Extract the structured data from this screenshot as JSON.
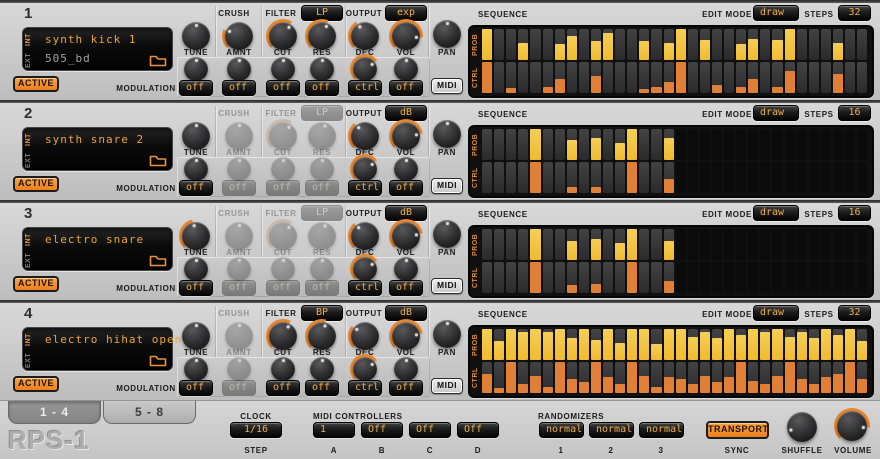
{
  "shared_labels": {
    "crush": "CRUSH",
    "filter": "FILTER",
    "output": "OUTPUT",
    "tune": "TUNE",
    "amnt": "AMNT",
    "cut": "CUT",
    "res": "RES",
    "dec": "DEC",
    "vol": "VOL",
    "pan": "PAN",
    "midi": "MIDI",
    "modulation": "MODULATION",
    "active": "ACTIVE",
    "sequence": "SEQUENCE",
    "edit_mode": "EDIT MODE",
    "steps": "STEPS",
    "prob": "PROB",
    "ctrl": "CTRL",
    "int": "INT",
    "ext": "EXT"
  },
  "colors": {
    "accent_orange": "#ee8626",
    "prob_bar": "#f2c33c",
    "ctrl_bar": "#e08036",
    "dropdown_text": "#edae4e"
  },
  "channels": [
    {
      "number": "1",
      "int_name": "synth kick 1",
      "ext_name": "505_bd",
      "filter_mode": "LP",
      "output_mode": "exp",
      "crush_disabled": false,
      "filter_disabled": false,
      "knobs": [
        {
          "v": 0.5,
          "arc": 0
        },
        {
          "v": 0.25,
          "arc": 1
        },
        {
          "v": 0.62,
          "arc": 1
        },
        {
          "v": 0.58,
          "arc": 1
        },
        {
          "v": 0.38,
          "arc": 1
        },
        {
          "v": 0.85,
          "arc": 1
        }
      ],
      "pan": {
        "v": 0.5,
        "arc": 0
      },
      "mod_knobs": [
        {
          "v": 0.5,
          "arc": 0
        },
        {
          "v": 0.5,
          "arc": 0
        },
        {
          "v": 0.5,
          "arc": 0
        },
        {
          "v": 0.5,
          "arc": 0
        },
        {
          "v": 0.7,
          "arc": 1
        },
        {
          "v": 0.5,
          "arc": 0
        }
      ],
      "mod_values": [
        "off",
        "off",
        "off",
        "off",
        "ctrl",
        "off"
      ],
      "sequence": {
        "edit_mode": "draw",
        "steps": 32,
        "prob": [
          1,
          0,
          0,
          0.55,
          0,
          0,
          0.5,
          0.78,
          0,
          0.62,
          0.88,
          0,
          0,
          0.6,
          0,
          0.55,
          1,
          0,
          0.65,
          0,
          0,
          0.5,
          0.68,
          0,
          0.65,
          1,
          0,
          0,
          0,
          0.55,
          0,
          0
        ],
        "ctrl": [
          1,
          0,
          0.15,
          0,
          0,
          0.2,
          0.45,
          0,
          0,
          0.55,
          0,
          0,
          0,
          0.12,
          0.18,
          0.35,
          1,
          0,
          0,
          0.25,
          0,
          0.2,
          0.45,
          0,
          0.2,
          0.7,
          0,
          0,
          0,
          0.6,
          0,
          0
        ]
      }
    },
    {
      "number": "2",
      "int_name": "synth snare 2",
      "ext_name": "",
      "filter_mode": "LP",
      "output_mode": "dB",
      "crush_disabled": true,
      "filter_disabled": true,
      "knobs": [
        {
          "v": 0.5,
          "arc": 0
        },
        {
          "v": 0.5,
          "arc": 0
        },
        {
          "v": 0.62,
          "arc": 1
        },
        {
          "v": 0.55,
          "arc": 0
        },
        {
          "v": 0.35,
          "arc": 1
        },
        {
          "v": 0.8,
          "arc": 1
        }
      ],
      "pan": {
        "v": 0.5,
        "arc": 0
      },
      "mod_knobs": [
        {
          "v": 0.5,
          "arc": 0
        },
        {
          "v": 0.5,
          "arc": 0
        },
        {
          "v": 0.5,
          "arc": 0
        },
        {
          "v": 0.5,
          "arc": 0
        },
        {
          "v": 0.7,
          "arc": 1
        },
        {
          "v": 0.5,
          "arc": 0
        }
      ],
      "mod_values": [
        "off",
        "off",
        "off",
        "off",
        "ctrl",
        "off"
      ],
      "sequence": {
        "edit_mode": "draw",
        "steps": 16,
        "prob": [
          0,
          0,
          0,
          0,
          1,
          0,
          0,
          0.65,
          0,
          0.7,
          0,
          0.55,
          1,
          0,
          0,
          0.72,
          0,
          0,
          0,
          0,
          0,
          0,
          0,
          0,
          0,
          0,
          0,
          0,
          0,
          0,
          0,
          0
        ],
        "ctrl": [
          0,
          0,
          0,
          0,
          1,
          0,
          0,
          0.2,
          0,
          0.2,
          0,
          0,
          1,
          0,
          0,
          0.45,
          0,
          0,
          0,
          0,
          0,
          0,
          0,
          0,
          0,
          0,
          0,
          0,
          0,
          0,
          0,
          0
        ]
      }
    },
    {
      "number": "3",
      "int_name": "electro snare",
      "ext_name": "",
      "filter_mode": "LP",
      "output_mode": "dB",
      "crush_disabled": true,
      "filter_disabled": true,
      "knobs": [
        {
          "v": 0.45,
          "arc": 1
        },
        {
          "v": 0.5,
          "arc": 0
        },
        {
          "v": 0.62,
          "arc": 1
        },
        {
          "v": 0.55,
          "arc": 0
        },
        {
          "v": 0.35,
          "arc": 1
        },
        {
          "v": 0.8,
          "arc": 1
        }
      ],
      "pan": {
        "v": 0.5,
        "arc": 0
      },
      "mod_knobs": [
        {
          "v": 0.5,
          "arc": 0
        },
        {
          "v": 0.5,
          "arc": 0
        },
        {
          "v": 0.5,
          "arc": 0
        },
        {
          "v": 0.5,
          "arc": 0
        },
        {
          "v": 0.7,
          "arc": 1
        },
        {
          "v": 0.5,
          "arc": 0
        }
      ],
      "mod_values": [
        "off",
        "off",
        "off",
        "off",
        "ctrl",
        "off"
      ],
      "sequence": {
        "edit_mode": "draw",
        "steps": 16,
        "prob": [
          0,
          0,
          0,
          0,
          1,
          0,
          0,
          0.6,
          0,
          0.68,
          0,
          0.55,
          1,
          0,
          0,
          0.6,
          0,
          0,
          0,
          0,
          0,
          0,
          0,
          0,
          0,
          0,
          0,
          0,
          0,
          0,
          0,
          0
        ],
        "ctrl": [
          0,
          0,
          0,
          0,
          1,
          0,
          0,
          0.25,
          0,
          0.28,
          0,
          0,
          1,
          0,
          0,
          0.4,
          0,
          0,
          0,
          0,
          0,
          0,
          0,
          0,
          0,
          0,
          0,
          0,
          0,
          0,
          0,
          0
        ]
      }
    },
    {
      "number": "4",
      "int_name": "electro hihat open",
      "ext_name": "",
      "filter_mode": "BP",
      "output_mode": "dB",
      "crush_disabled": true,
      "filter_disabled": false,
      "knobs": [
        {
          "v": 0.5,
          "arc": 0
        },
        {
          "v": 0.5,
          "arc": 0
        },
        {
          "v": 0.6,
          "arc": 1
        },
        {
          "v": 0.55,
          "arc": 1
        },
        {
          "v": 0.3,
          "arc": 1
        },
        {
          "v": 0.8,
          "arc": 1
        }
      ],
      "pan": {
        "v": 0.5,
        "arc": 0
      },
      "mod_knobs": [
        {
          "v": 0.5,
          "arc": 0
        },
        {
          "v": 0.5,
          "arc": 0
        },
        {
          "v": 0.5,
          "arc": 0
        },
        {
          "v": 0.5,
          "arc": 0
        },
        {
          "v": 0.7,
          "arc": 1
        },
        {
          "v": 0.5,
          "arc": 0
        }
      ],
      "mod_values": [
        "off",
        "off",
        "off",
        "off",
        "ctrl",
        "off"
      ],
      "sequence": {
        "edit_mode": "draw",
        "steps": 32,
        "prob": [
          1,
          0.6,
          1,
          0.9,
          1,
          0.9,
          1,
          0.7,
          1,
          0.65,
          1,
          0.55,
          1,
          1,
          0.5,
          1,
          1,
          0.75,
          0.9,
          0.7,
          1,
          0.8,
          1,
          0.9,
          1,
          0.75,
          0.9,
          0.7,
          1,
          0.8,
          1,
          0.6
        ],
        "ctrl": [
          0.6,
          0.15,
          1,
          0.3,
          0.55,
          0.2,
          1,
          0.45,
          0.35,
          1,
          0.5,
          0.3,
          1,
          0.55,
          0.2,
          0.5,
          0.45,
          0.3,
          0.55,
          0.35,
          0.5,
          1,
          0.4,
          0.3,
          0.55,
          1,
          0.45,
          0.3,
          0.5,
          0.6,
          1,
          0.45
        ]
      }
    }
  ],
  "bottom": {
    "tabs": [
      {
        "label": "1 - 4",
        "selected": true
      },
      {
        "label": "5 - 8",
        "selected": false
      }
    ],
    "logo": "RPS-1",
    "clock": {
      "label": "CLOCK",
      "value": "1/16",
      "sub_label": "STEP"
    },
    "midi_controllers": {
      "label": "MIDI CONTROLLERS",
      "items": [
        {
          "value": "1",
          "sub": "A"
        },
        {
          "value": "Off",
          "sub": "B"
        },
        {
          "value": "Off",
          "sub": "C"
        },
        {
          "value": "Off",
          "sub": "D"
        }
      ]
    },
    "randomizers": {
      "label": "RANDOMIZERS",
      "items": [
        {
          "value": "normal",
          "sub": "1"
        },
        {
          "value": "normal",
          "sub": "2"
        },
        {
          "value": "normal",
          "sub": "3"
        }
      ]
    },
    "transport": {
      "label": "TRANSPORT",
      "sub_label": "SYNC"
    },
    "shuffle": {
      "label": "SHUFFLE",
      "v": 0.1
    },
    "volume": {
      "label": "VOLUME",
      "v": 0.85
    }
  }
}
